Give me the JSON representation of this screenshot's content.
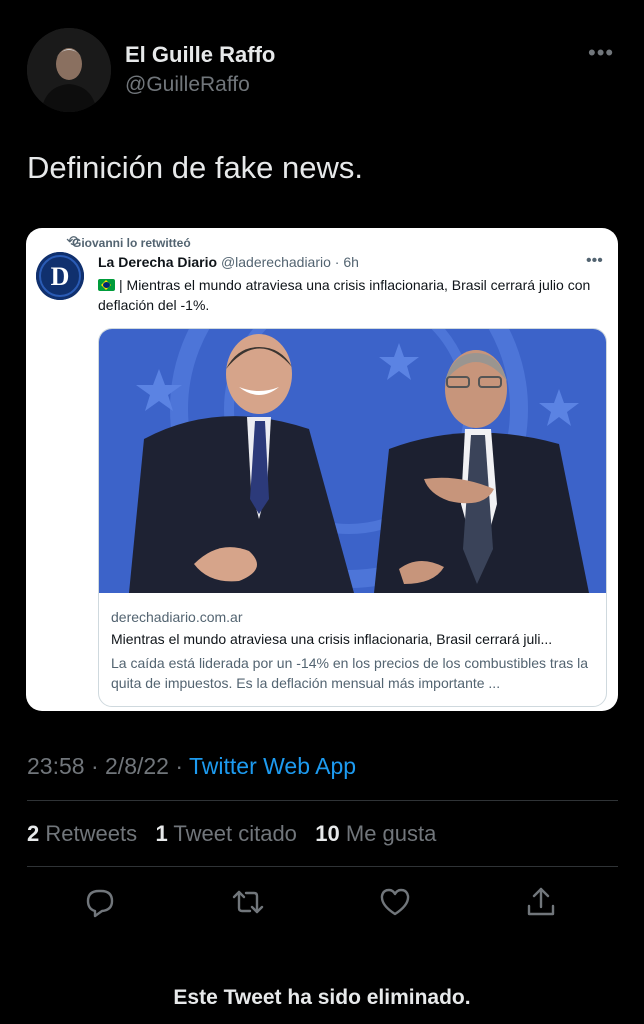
{
  "author": {
    "name": "El Guille Raffo",
    "handle": "@GuilleRaffo",
    "more_icon": "more-horizontal-icon"
  },
  "tweet": {
    "text": "Definición de fake news.",
    "time": "23:58",
    "date": "2/8/22",
    "separator": "·",
    "app": "Twitter Web App"
  },
  "embedded": {
    "retweeted_by": "Giovanni lo retwitteó",
    "name": "La Derecha Diario",
    "handle": "@laderechadiario",
    "age": "6h",
    "text": "| Mientras el mundo atraviesa una crisis inflacionaria, Brasil cerrará julio con deflación del -1%.",
    "avatar_letter": "D",
    "link": {
      "domain": "derechadiario.com.ar",
      "title": "Mientras el mundo atraviesa una crisis inflacionaria, Brasil cerrará juli...",
      "description": "La caída está liderada por un -14% en los precios de los combustibles tras la quita de impuestos. Es la deflación mensual más importante ..."
    }
  },
  "stats": {
    "retweets_count": "2",
    "retweets_label": "Retweets",
    "quotes_count": "1",
    "quotes_label": "Tweet citado",
    "likes_count": "10",
    "likes_label": "Me gusta"
  },
  "actions": [
    "reply-icon",
    "retweet-icon",
    "like-icon",
    "share-icon"
  ],
  "footer": {
    "deleted_notice": "Este Tweet ha sido eliminado."
  },
  "colors": {
    "background": "#000000",
    "accent": "#1d9bf0",
    "secondary_text": "#71767b"
  }
}
